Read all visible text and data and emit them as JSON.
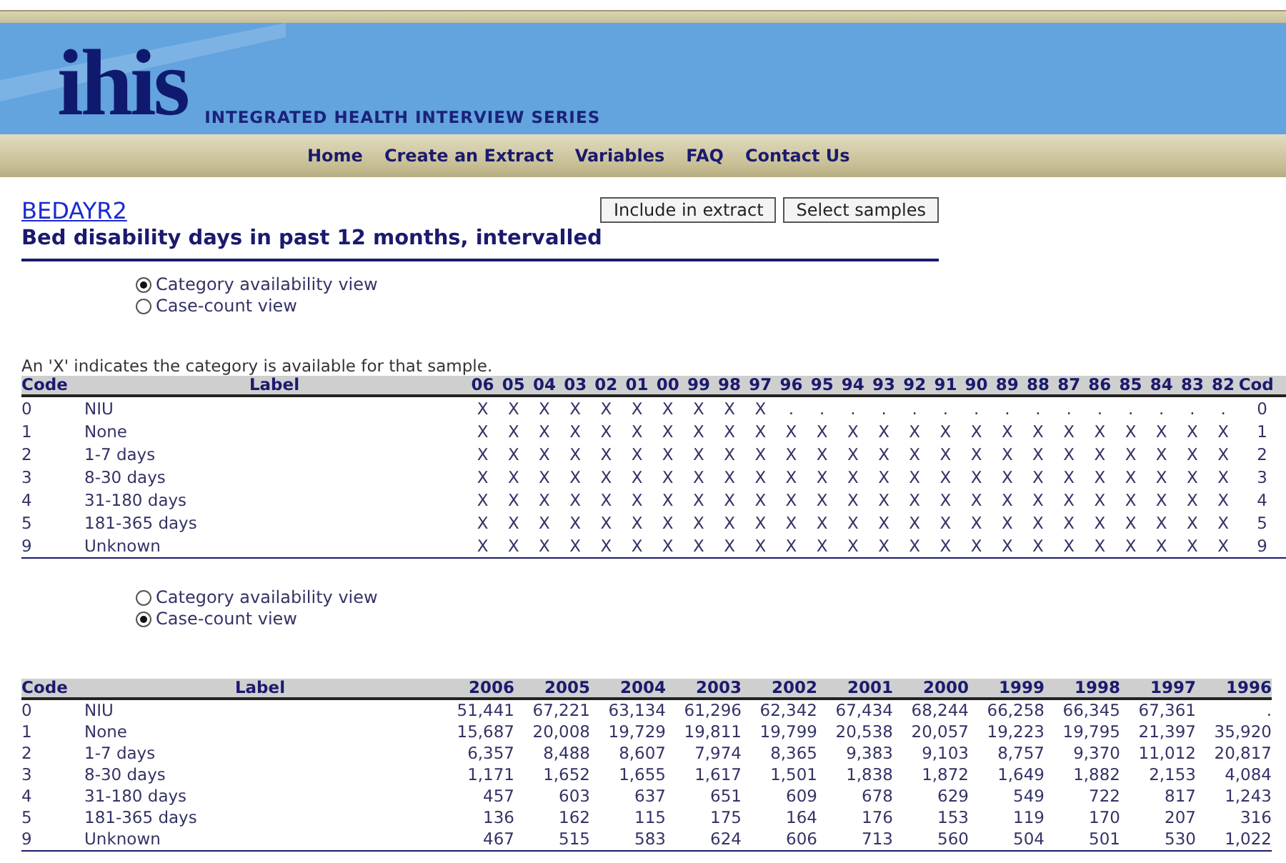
{
  "header": {
    "logo": "ihis",
    "tagline": "INTEGRATED HEALTH INTERVIEW SERIES"
  },
  "nav": [
    {
      "label": "Home"
    },
    {
      "label": "Create an Extract"
    },
    {
      "label": "Variables"
    },
    {
      "label": "FAQ"
    },
    {
      "label": "Contact Us"
    }
  ],
  "variable": {
    "code": "BEDAYR2",
    "description": "Bed disability days in past 12 months, intervalled"
  },
  "buttons": [
    "Include in extract",
    "Select samples"
  ],
  "views_top": [
    {
      "label": "Category availability view",
      "selected": true
    },
    {
      "label": "Case-count view",
      "selected": false
    }
  ],
  "availability": {
    "note": "An 'X' indicates the category is available for that sample.",
    "code_heading": "Code",
    "label_heading": "Label",
    "columns": [
      "06",
      "05",
      "04",
      "03",
      "02",
      "01",
      "00",
      "99",
      "98",
      "97",
      "96",
      "95",
      "94",
      "93",
      "92",
      "91",
      "90",
      "89",
      "88",
      "87",
      "86",
      "85",
      "84",
      "83",
      "82"
    ],
    "end_heading": "Cod",
    "rows": [
      {
        "code": "0",
        "label": "NIU",
        "cells": [
          "X",
          "X",
          "X",
          "X",
          "X",
          "X",
          "X",
          "X",
          "X",
          "X",
          ".",
          ".",
          ".",
          ".",
          ".",
          ".",
          ".",
          ".",
          ".",
          ".",
          ".",
          ".",
          ".",
          ".",
          "."
        ],
        "end_code": "0"
      },
      {
        "code": "1",
        "label": "None",
        "cells": [
          "X",
          "X",
          "X",
          "X",
          "X",
          "X",
          "X",
          "X",
          "X",
          "X",
          "X",
          "X",
          "X",
          "X",
          "X",
          "X",
          "X",
          "X",
          "X",
          "X",
          "X",
          "X",
          "X",
          "X",
          "X"
        ],
        "end_code": "1"
      },
      {
        "code": "2",
        "label": "1-7 days",
        "cells": [
          "X",
          "X",
          "X",
          "X",
          "X",
          "X",
          "X",
          "X",
          "X",
          "X",
          "X",
          "X",
          "X",
          "X",
          "X",
          "X",
          "X",
          "X",
          "X",
          "X",
          "X",
          "X",
          "X",
          "X",
          "X"
        ],
        "end_code": "2"
      },
      {
        "code": "3",
        "label": "8-30 days",
        "cells": [
          "X",
          "X",
          "X",
          "X",
          "X",
          "X",
          "X",
          "X",
          "X",
          "X",
          "X",
          "X",
          "X",
          "X",
          "X",
          "X",
          "X",
          "X",
          "X",
          "X",
          "X",
          "X",
          "X",
          "X",
          "X"
        ],
        "end_code": "3"
      },
      {
        "code": "4",
        "label": "31-180 days",
        "cells": [
          "X",
          "X",
          "X",
          "X",
          "X",
          "X",
          "X",
          "X",
          "X",
          "X",
          "X",
          "X",
          "X",
          "X",
          "X",
          "X",
          "X",
          "X",
          "X",
          "X",
          "X",
          "X",
          "X",
          "X",
          "X"
        ],
        "end_code": "4"
      },
      {
        "code": "5",
        "label": "181-365 days",
        "cells": [
          "X",
          "X",
          "X",
          "X",
          "X",
          "X",
          "X",
          "X",
          "X",
          "X",
          "X",
          "X",
          "X",
          "X",
          "X",
          "X",
          "X",
          "X",
          "X",
          "X",
          "X",
          "X",
          "X",
          "X",
          "X"
        ],
        "end_code": "5"
      },
      {
        "code": "9",
        "label": "Unknown",
        "cells": [
          "X",
          "X",
          "X",
          "X",
          "X",
          "X",
          "X",
          "X",
          "X",
          "X",
          "X",
          "X",
          "X",
          "X",
          "X",
          "X",
          "X",
          "X",
          "X",
          "X",
          "X",
          "X",
          "X",
          "X",
          "X"
        ],
        "end_code": "9"
      }
    ]
  },
  "views_bottom": [
    {
      "label": "Category availability view",
      "selected": false
    },
    {
      "label": "Case-count view",
      "selected": true
    }
  ],
  "case_counts": {
    "code_heading": "Code",
    "label_heading": "Label",
    "columns": [
      "2006",
      "2005",
      "2004",
      "2003",
      "2002",
      "2001",
      "2000",
      "1999",
      "1998",
      "1997",
      "1996"
    ],
    "rows": [
      {
        "code": "0",
        "label": "NIU",
        "values": [
          "51,441",
          "67,221",
          "63,134",
          "61,296",
          "62,342",
          "67,434",
          "68,244",
          "66,258",
          "66,345",
          "67,361",
          "."
        ]
      },
      {
        "code": "1",
        "label": "None",
        "values": [
          "15,687",
          "20,008",
          "19,729",
          "19,811",
          "19,799",
          "20,538",
          "20,057",
          "19,223",
          "19,795",
          "21,397",
          "35,920"
        ]
      },
      {
        "code": "2",
        "label": "1-7 days",
        "values": [
          "6,357",
          "8,488",
          "8,607",
          "7,974",
          "8,365",
          "9,383",
          "9,103",
          "8,757",
          "9,370",
          "11,012",
          "20,817"
        ]
      },
      {
        "code": "3",
        "label": "8-30 days",
        "values": [
          "1,171",
          "1,652",
          "1,655",
          "1,617",
          "1,501",
          "1,838",
          "1,872",
          "1,649",
          "1,882",
          "2,153",
          "4,084"
        ]
      },
      {
        "code": "4",
        "label": "31-180 days",
        "values": [
          "457",
          "603",
          "637",
          "651",
          "609",
          "678",
          "629",
          "549",
          "722",
          "817",
          "1,243"
        ]
      },
      {
        "code": "5",
        "label": "181-365 days",
        "values": [
          "136",
          "162",
          "115",
          "175",
          "164",
          "176",
          "153",
          "119",
          "170",
          "207",
          "316"
        ]
      },
      {
        "code": "9",
        "label": "Unknown",
        "values": [
          "467",
          "515",
          "583",
          "624",
          "606",
          "713",
          "560",
          "504",
          "501",
          "530",
          "1,022"
        ]
      }
    ]
  }
}
